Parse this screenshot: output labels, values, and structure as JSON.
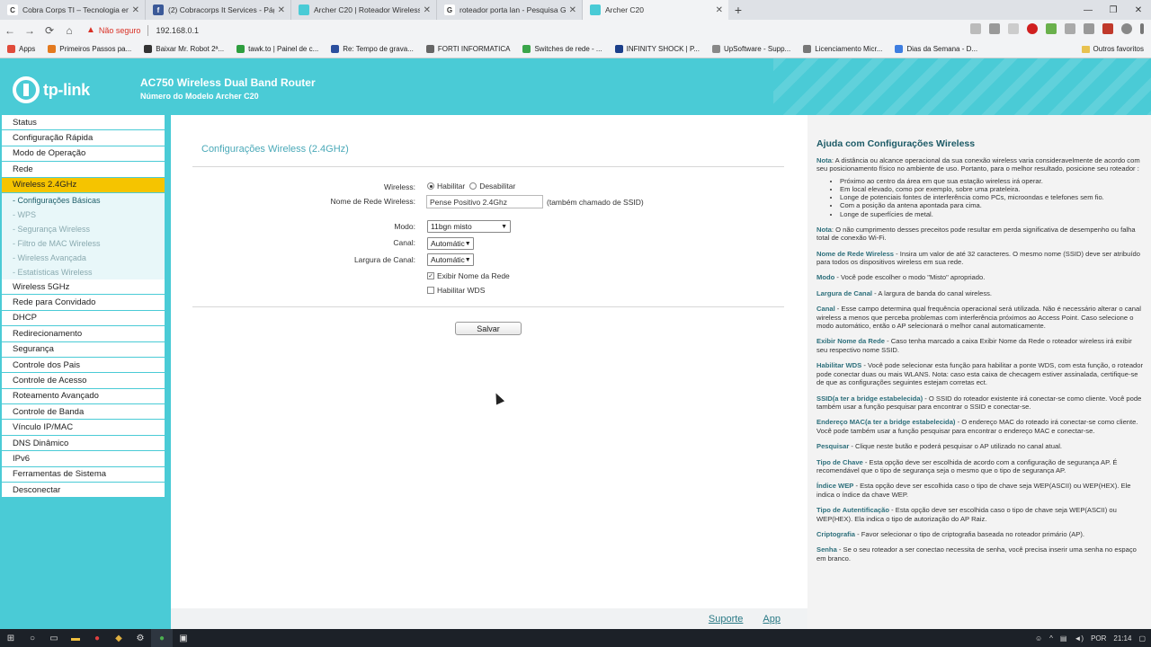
{
  "browser": {
    "tabs": [
      {
        "title": "Cobra Corps TI – Tecnologia em",
        "fav_color": "#ffffff",
        "fav_text": "C"
      },
      {
        "title": "(2) Cobracorps It Services - Págin",
        "fav_color": "#3b5998",
        "fav_text": "f"
      },
      {
        "title": "Archer C20 | Roteador Wireless D",
        "fav_color": "#4acbd6",
        "fav_text": ""
      },
      {
        "title": "roteador porta lan - Pesquisa Go",
        "fav_color": "#ffffff",
        "fav_text": "G"
      },
      {
        "title": "Archer C20",
        "fav_color": "#4acbd6",
        "fav_text": ""
      }
    ],
    "insecure_label": "Não seguro",
    "url": "192.168.0.1",
    "bookmarks": [
      {
        "label": "Apps",
        "color": "#e04b3b"
      },
      {
        "label": "Primeiros Passos pa...",
        "color": "#e37a1f"
      },
      {
        "label": "Baixar Mr. Robot 2ª...",
        "color": "#333333"
      },
      {
        "label": "tawk.to | Painel de c...",
        "color": "#2e9e3f"
      },
      {
        "label": "Re: Tempo de grava...",
        "color": "#2b4f9e"
      },
      {
        "label": "FORTI INFORMATICA",
        "color": "#666666"
      },
      {
        "label": "Switches de rede - ...",
        "color": "#3aa54a"
      },
      {
        "label": "INFINITY SHOCK | P...",
        "color": "#1b3f8a"
      },
      {
        "label": "UpSoftware - Supp...",
        "color": "#888888"
      },
      {
        "label": "Licenciamento Micr...",
        "color": "#777777"
      },
      {
        "label": "Dias da Semana - D...",
        "color": "#3d7de0"
      }
    ],
    "other_bookmarks": "Outros favoritos"
  },
  "header": {
    "logo": "tp-link",
    "title": "AC750 Wireless Dual Band Router",
    "model": "Número do Modelo Archer C20"
  },
  "menu": [
    {
      "label": "Status",
      "type": "item"
    },
    {
      "label": "Configuração Rápida",
      "type": "item"
    },
    {
      "label": "Modo de Operação",
      "type": "item"
    },
    {
      "label": "Rede",
      "type": "item"
    },
    {
      "label": "Wireless 2.4GHz",
      "type": "active"
    },
    {
      "label": "- Configurações Básicas",
      "type": "sub-on"
    },
    {
      "label": "- WPS",
      "type": "sub"
    },
    {
      "label": "- Segurança Wireless",
      "type": "sub"
    },
    {
      "label": "- Filtro de MAC Wireless",
      "type": "sub"
    },
    {
      "label": "- Wireless Avançada",
      "type": "sub"
    },
    {
      "label": "- Estatísticas Wireless",
      "type": "sub"
    },
    {
      "label": "Wireless 5GHz",
      "type": "item"
    },
    {
      "label": "Rede para Convidado",
      "type": "item"
    },
    {
      "label": "DHCP",
      "type": "item"
    },
    {
      "label": "Redirecionamento",
      "type": "item"
    },
    {
      "label": "Segurança",
      "type": "item"
    },
    {
      "label": "Controle dos Pais",
      "type": "item"
    },
    {
      "label": "Controle de Acesso",
      "type": "item"
    },
    {
      "label": "Roteamento Avançado",
      "type": "item"
    },
    {
      "label": "Controle de Banda",
      "type": "item"
    },
    {
      "label": "Vínculo IP/MAC",
      "type": "item"
    },
    {
      "label": "DNS Dinâmico",
      "type": "item"
    },
    {
      "label": "IPv6",
      "type": "item"
    },
    {
      "label": "Ferramentas de Sistema",
      "type": "item"
    },
    {
      "label": "Desconectar",
      "type": "item"
    }
  ],
  "form": {
    "section_title": "Configurações Wireless (2.4GHz)",
    "wireless_label": "Wireless:",
    "enable_label": "Habilitar",
    "disable_label": "Desabilitar",
    "ssid_label": "Nome de Rede Wireless:",
    "ssid_value": "Pense Positivo 2.4Ghz",
    "ssid_hint": "(também chamado de SSID)",
    "mode_label": "Modo:",
    "mode_value": "11bgn misto",
    "channel_label": "Canal:",
    "channel_value": "Automátic",
    "width_label": "Largura de Canal:",
    "width_value": "Automátic",
    "broadcast_label": "Exibir Nome da Rede",
    "wds_label": "Habilitar WDS",
    "save_label": "Salvar"
  },
  "footer": {
    "support": "Suporte",
    "app": "App"
  },
  "help": {
    "title": "Ajuda com Configurações Wireless",
    "note1_key": "Nota",
    "note1": ": A distância ou alcance operacional da sua conexão wireless varia consideravelmente de acordo com seu posicionamento físico no ambiente de uso. Portanto, para o melhor resultado, posicione seu roteador :",
    "bullets": [
      "Próximo ao centro da área em que sua estação wireless irá operar.",
      "Em local elevado, como por exemplo, sobre uma prateleira.",
      "Longe de potenciais fontes de interferência como PCs, microondas e telefones sem fio.",
      "Com a posição da antena apontada para cima.",
      "Longe de superfícies de metal."
    ],
    "items": [
      {
        "key": "Nota",
        "text": ": O não cumprimento desses preceitos pode resultar em perda significativa de desempenho ou falha total de conexão Wi-Fi."
      },
      {
        "key": "Nome de Rede Wireless",
        "text": " - Insira um valor de até 32 caracteres. O mesmo nome (SSID) deve ser atribuído para todos os dispositivos wireless em sua rede."
      },
      {
        "key": "Modo",
        "text": " - Você pode escolher o modo \"Misto\" apropriado."
      },
      {
        "key": "Largura de Canal",
        "text": " - A largura de banda do canal wireless."
      },
      {
        "key": "Canal",
        "text": " - Esse campo determina qual frequência operacional será utilizada. Não é necessário alterar o canal wireless a menos que perceba problemas com interferência próximos ao Access Point. Caso selecione o modo automático, então o AP selecionará o melhor canal automaticamente."
      },
      {
        "key": "Exibir Nome da Rede",
        "text": " - Caso tenha marcado a caixa Exibir Nome da Rede o roteador wireless irá exibir seu respectivo nome SSID."
      },
      {
        "key": "Habilitar WDS",
        "text": " - Você pode selecionar esta função para habilitar a ponte WDS, com esta função, o roteador pode conectar duas ou mais WLANS. Nota: caso esta caixa de checagem estiver assinalada, certifique-se de que as configurações seguintes estejam corretas ect."
      },
      {
        "key": "SSID(a ter a bridge estabelecida)",
        "text": " - O SSID do roteador existente irá conectar-se como cliente. Você pode também usar a função pesquisar para encontrar o SSID e conectar-se."
      },
      {
        "key": "Endereço MAC(a ter a bridge estabelecida)",
        "text": " - O endereço MAC do roteado irá conectar-se como cliente. Você pode também usar a função pesquisar para encontrar o endereço MAC e conectar-se."
      },
      {
        "key": "Pesquisar",
        "text": " - Clique neste butão e poderá pesquisar o AP utilizado no canal atual."
      },
      {
        "key": "Tipo de Chave",
        "text": " - Esta opção deve ser escolhida de acordo com a configuração de segurança AP. É recomendável que o tipo de segurança seja o mesmo que o tipo de segurança AP."
      },
      {
        "key": "Índice WEP",
        "text": " - Esta opção deve ser escolhida caso o tipo de chave seja WEP(ASCII) ou WEP(HEX). Ele indica o índice da chave WEP."
      },
      {
        "key": "Tipo de Autentificação",
        "text": " - Esta opção deve ser escolhida caso o tipo de chave seja WEP(ASCII) ou WEP(HEX). Ela indica o tipo de autorização do AP Raiz."
      },
      {
        "key": "Criptografia",
        "text": " - Favor selecionar o tipo de criptografia baseada no roteador primário (AP)."
      },
      {
        "key": "Senha",
        "text": " - Se o seu roteador a ser conectao necessita de senha, você precisa inserir uma senha no espaço em branco."
      }
    ]
  },
  "taskbar": {
    "lang": "POR",
    "time": "21:14"
  }
}
